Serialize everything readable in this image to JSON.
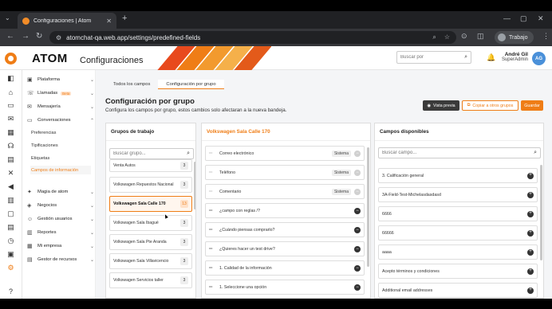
{
  "browser": {
    "tab_title": "Configuraciones | Atom",
    "url": "atomchat-qa.web.app/settings/predefined-fields",
    "profile_name": "Trabajo"
  },
  "header": {
    "brand": "ATOM",
    "page_title": "Configuraciones",
    "search_placeholder": "Buscar por",
    "user_name": "André Gil",
    "user_role": "SuperAdmin",
    "user_initials": "AG",
    "accent_color": "#ef7d16",
    "stripe_colors": [
      "#e8491d",
      "#ef7d16",
      "#f29a2e",
      "#f5b04a",
      "#e35a1a"
    ]
  },
  "sidebar": {
    "items": [
      {
        "label": "Plataforma",
        "icon": "app-icon",
        "chev": "⌄"
      },
      {
        "label": "Llamadas",
        "icon": "phone-icon",
        "badge": "Beta",
        "chev": "⌄"
      },
      {
        "label": "Mensajería",
        "icon": "message-icon",
        "chev": "⌄"
      },
      {
        "label": "Conversaciones",
        "icon": "chat-icon",
        "chev": "⌃"
      }
    ],
    "subitems": [
      {
        "label": "Preferencias"
      },
      {
        "label": "Tipificaciones"
      },
      {
        "label": "Etiquetas"
      },
      {
        "label": "Campos de información"
      }
    ],
    "items2": [
      {
        "label": "Magia de atom",
        "icon": "magic-icon",
        "chev": "⌄"
      },
      {
        "label": "Negocios",
        "icon": "tag-icon",
        "chev": "⌄"
      },
      {
        "label": "Gestión usuarios",
        "icon": "users-icon",
        "chev": "⌄"
      },
      {
        "label": "Reportes",
        "icon": "report-icon",
        "chev": "⌄"
      },
      {
        "label": "Mi empresa",
        "icon": "building-icon",
        "chev": "⌄"
      },
      {
        "label": "Gestor de recursos",
        "icon": "resources-icon",
        "chev": "⌄"
      }
    ]
  },
  "main": {
    "tabs": [
      {
        "label": "Todos los campos"
      },
      {
        "label": "Configuración por grupo"
      }
    ],
    "title": "Configuración por grupo",
    "subtitle": "Configura los campos por grupo, estos cambios solo afectaran a la nueva bandeja.",
    "btn_preview": "Vista previa",
    "btn_copy": "Copiar a otros grupos",
    "btn_save": "Guardar"
  },
  "groups": {
    "header": "Grupos de trabajo",
    "search_placeholder": "Buscar grupo...",
    "items": [
      {
        "name": "Venta Autos",
        "count": "3"
      },
      {
        "name": "Volkswagen Repuestos Nacional",
        "count": "3"
      },
      {
        "name": "Volkswagen Sala Calle 170",
        "count": "13"
      },
      {
        "name": "Volkswagen Sala Ibagué",
        "count": "3"
      },
      {
        "name": "Volkswagen Sala Pte Aranda",
        "count": "3"
      },
      {
        "name": "Volkswagen Sala Villavicencio",
        "count": "3"
      },
      {
        "name": "Volkswagen Servicios taller",
        "count": "3"
      }
    ]
  },
  "selected": {
    "header": "Volkswagen Sala Calle 170",
    "fields": [
      {
        "label": "Correo electrónico",
        "tag": "Sistema"
      },
      {
        "label": "Teléfono",
        "tag": "Sistema"
      },
      {
        "label": "Comentario",
        "tag": "Sistema"
      },
      {
        "label": "¿campo con reglas /?"
      },
      {
        "label": "¿Cuándo piensas comprarlo?"
      },
      {
        "label": "¿Quieres hacer un test drive?"
      },
      {
        "label": "1. Calidad de la información"
      },
      {
        "label": "1. Seleccione una opción"
      }
    ]
  },
  "available": {
    "header": "Campos disponibles",
    "search_placeholder": "Buscar campo...",
    "items": [
      {
        "label": "3. Calificación general"
      },
      {
        "label": "3A-Field-Test-Michelasdasdasd"
      },
      {
        "label": "6666"
      },
      {
        "label": "66666"
      },
      {
        "label": "aaaa"
      },
      {
        "label": "Acepto términos y condiciones"
      },
      {
        "label": "Additional email addresses"
      }
    ]
  }
}
